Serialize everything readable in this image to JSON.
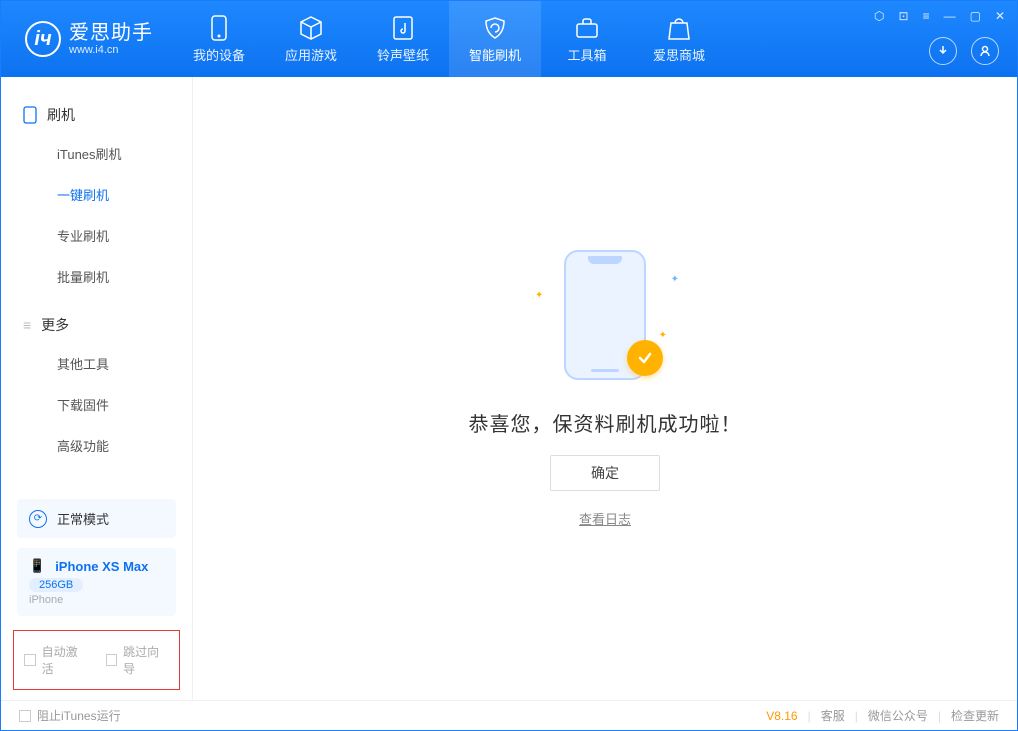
{
  "app": {
    "title": "爱思助手",
    "url": "www.i4.cn"
  },
  "nav": {
    "device": "我的设备",
    "apps": "应用游戏",
    "ringtones": "铃声壁纸",
    "flash": "智能刷机",
    "toolbox": "工具箱",
    "store": "爱思商城"
  },
  "sidebar": {
    "group_flash": "刷机",
    "items": {
      "itunes": "iTunes刷机",
      "onekey": "一键刷机",
      "pro": "专业刷机",
      "batch": "批量刷机"
    },
    "group_more": "更多",
    "more": {
      "other": "其他工具",
      "firmware": "下载固件",
      "advanced": "高级功能"
    },
    "mode": "正常模式",
    "device": {
      "name": "iPhone XS Max",
      "capacity": "256GB",
      "type": "iPhone"
    },
    "checkbox_auto": "自动激活",
    "checkbox_skip": "跳过向导"
  },
  "main": {
    "success": "恭喜您，保资料刷机成功啦！",
    "ok": "确定",
    "view_log": "查看日志"
  },
  "footer": {
    "block_itunes": "阻止iTunes运行",
    "version": "V8.16",
    "support": "客服",
    "wechat": "微信公众号",
    "update": "检查更新"
  }
}
